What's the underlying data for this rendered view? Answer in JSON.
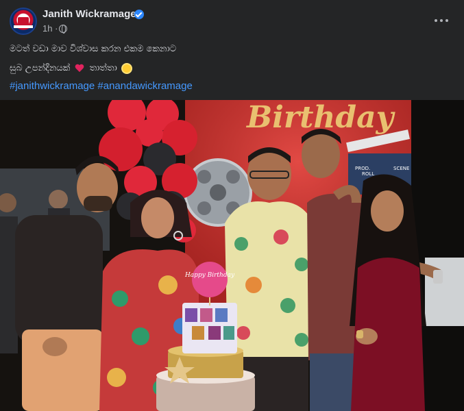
{
  "post": {
    "author": "Janith Wickramage",
    "time": "1h",
    "separator": "·",
    "privacy_icon": "globe-icon",
    "more_icon": "more-horizontal-icon",
    "caption_line_1": "මටත් වඩා මාව විශ්වාස කරන එකම කෙනාට",
    "caption_line_2_text": "සුබ උපන්දිනයක්",
    "caption_line_2_suffix": "තාත්තා",
    "hashtags": [
      "#janithwickramage",
      "#anandawickramage"
    ],
    "photo": {
      "banner_text": "Birthday",
      "clapper_labels": [
        "PROD.",
        "ROLL",
        "SCENE"
      ],
      "cake_topper": "Happy Birthday"
    }
  },
  "colors": {
    "card_bg": "#242526",
    "text_primary": "#e4e6eb",
    "text_secondary": "#b0b3b8",
    "link": "#4599ff",
    "verified": "#2d88ff"
  }
}
